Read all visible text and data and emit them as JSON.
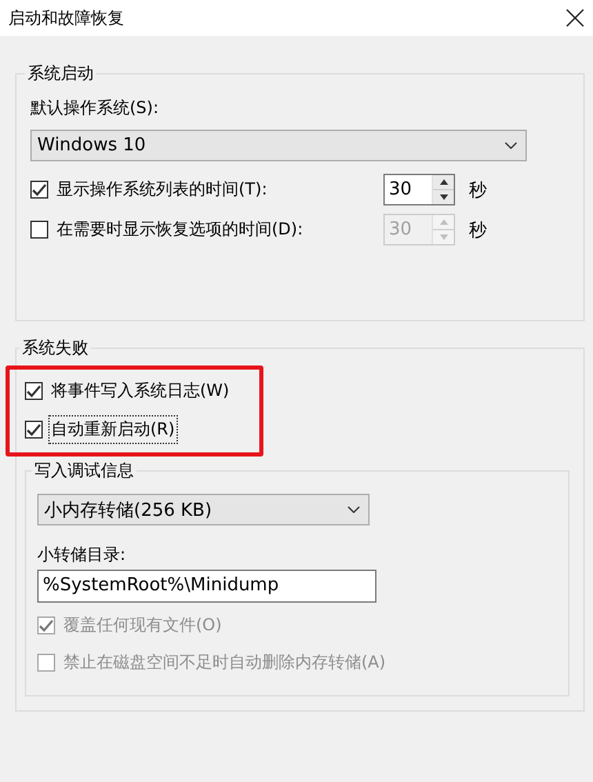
{
  "window": {
    "title": "启动和故障恢复"
  },
  "system_startup": {
    "title": "系统启动",
    "default_os_label": "默认操作系统(S):",
    "default_os": "Windows 10",
    "options": [
      {
        "label": "显示操作系统列表的时间(T):",
        "checked": true,
        "value": "30",
        "value_disabled": false,
        "unit": "秒"
      },
      {
        "label": "在需要时显示恢复选项的时间(D):",
        "checked": false,
        "value": "30",
        "value_disabled": true,
        "unit": "秒"
      }
    ]
  },
  "system_failure": {
    "title": "系统失败",
    "highlighted": true,
    "options": [
      {
        "label": "将事件写入系统日志(W)",
        "checked": true,
        "focused": false
      },
      {
        "label": "自动重新启动(R)",
        "checked": true,
        "focused": true
      }
    ],
    "debug_info": {
      "title": "写入调试信息",
      "dump_type": "小内存转储(256 KB)",
      "dump_dir_label": "小转储目录:",
      "dump_dir": "%SystemRoot%\\Minidump",
      "options": [
        {
          "label": "覆盖任何现有文件(O)",
          "checked": true,
          "disabled": true
        },
        {
          "label": "禁止在磁盘空间不足时自动删除内存转储(A)",
          "checked": false,
          "disabled": true
        }
      ]
    }
  }
}
